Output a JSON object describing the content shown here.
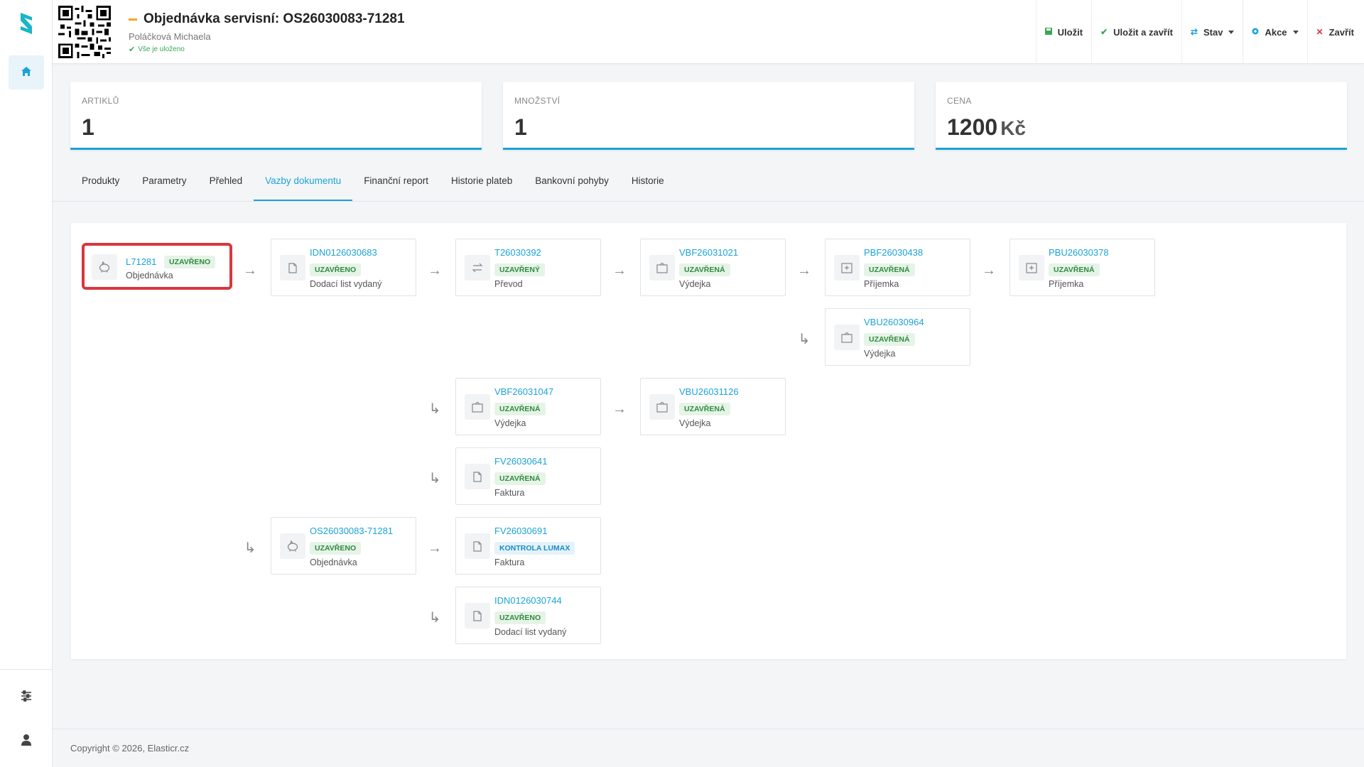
{
  "app": {
    "brand_color": "#1ba3d8",
    "accent_red": "#d9363e"
  },
  "sidebar": {
    "home_icon": "home-icon",
    "settings_icon": "sliders-icon",
    "user_icon": "user-icon"
  },
  "header": {
    "title": "Objednávka servisní: OS26030083-71281",
    "user": "Poláčková Michaela",
    "saved_status": "Vše je uloženo",
    "toolbar": {
      "save": "Uložit",
      "save_close": "Uložit a zavřít",
      "state": "Stav",
      "actions": "Akce",
      "close": "Zavřít"
    }
  },
  "stats": [
    {
      "label": "Artiklů",
      "value": "1",
      "unit": ""
    },
    {
      "label": "Množství",
      "value": "1",
      "unit": ""
    },
    {
      "label": "Cena",
      "value": "1200",
      "unit": "Kč"
    }
  ],
  "tabs": [
    "Produkty",
    "Parametry",
    "Přehled",
    "Vazby dokumentu",
    "Finanční report",
    "Historie plateb",
    "Bankovní pohyby",
    "Historie"
  ],
  "active_tab": "Vazby dokumentu",
  "nodes": {
    "root": {
      "code": "L71281",
      "status": "UZAVŘENO",
      "type": "Objednávka",
      "icon": "piggy-bank-icon"
    },
    "n1": {
      "code": "IDN0126030683",
      "status": "UZAVŘENO",
      "type": "Dodací list vydaný",
      "icon": "document-icon"
    },
    "n2": {
      "code": "T26030392",
      "status": "UZAVŘENÝ",
      "type": "Převod",
      "icon": "transfer-icon"
    },
    "n3": {
      "code": "VBF26031021",
      "status": "UZAVŘENÁ",
      "type": "Výdejka",
      "icon": "box-out-icon"
    },
    "n4": {
      "code": "PBF26030438",
      "status": "UZAVŘENÁ",
      "type": "Příjemka",
      "icon": "box-in-icon"
    },
    "n5": {
      "code": "PBU26030378",
      "status": "UZAVŘENÁ",
      "type": "Příjemka",
      "icon": "box-in-icon"
    },
    "n6": {
      "code": "VBU26030964",
      "status": "UZAVŘENÁ",
      "type": "Výdejka",
      "icon": "box-out-icon"
    },
    "n7": {
      "code": "VBF26031047",
      "status": "UZAVŘENÁ",
      "type": "Výdejka",
      "icon": "box-out-icon"
    },
    "n8": {
      "code": "VBU26031126",
      "status": "UZAVŘENÁ",
      "type": "Výdejka",
      "icon": "box-out-icon"
    },
    "n9": {
      "code": "FV26030641",
      "status": "UZAVŘENÁ",
      "type": "Faktura",
      "icon": "document-icon"
    },
    "n10": {
      "code": "OS26030083-71281",
      "status": "UZAVŘENO",
      "type": "Objednávka",
      "icon": "piggy-bank-icon"
    },
    "n11": {
      "code": "FV26030691",
      "status": "KONTROLA LUMAX",
      "type": "Faktura",
      "icon": "document-icon"
    },
    "n12": {
      "code": "IDN0126030744",
      "status": "UZAVŘENO",
      "type": "Dodací list vydaný",
      "icon": "document-icon"
    }
  },
  "footer": {
    "copyright": "Copyright © 2026, Elasticr.cz"
  }
}
